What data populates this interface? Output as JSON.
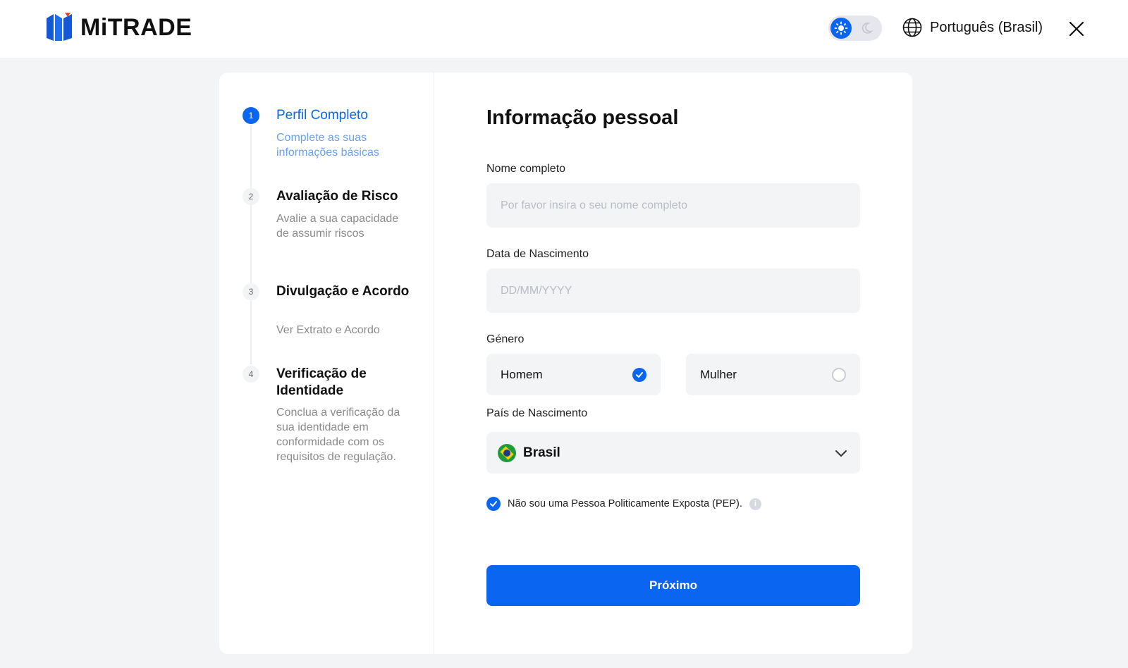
{
  "header": {
    "brand": "MiTRADE",
    "language": "Português (Brasil)"
  },
  "steps": [
    {
      "number": "1",
      "title": "Perfil Completo",
      "description": "Complete as suas informações básicas",
      "active": true
    },
    {
      "number": "2",
      "title": "Avaliação de Risco",
      "description": "Avalie a sua capacidade de assumir riscos",
      "active": false
    },
    {
      "number": "3",
      "title": "Divulgação e Acordo",
      "description": "Ver Extrato e Acordo",
      "active": false
    },
    {
      "number": "4",
      "title": "Verificação de Identidade",
      "description": "Conclua a verificação da sua identidade em conformidade com os requisitos de regulação.",
      "active": false
    }
  ],
  "form": {
    "title": "Informação pessoal",
    "full_name": {
      "label": "Nome completo",
      "placeholder": "Por favor insira o seu nome completo",
      "value": ""
    },
    "birth_date": {
      "label": "Data de Nascimento",
      "placeholder": "DD/MM/YYYY",
      "value": ""
    },
    "gender": {
      "label": "Género",
      "options": [
        "Homem",
        "Mulher"
      ],
      "selected": "Homem"
    },
    "birth_country": {
      "label": "País de Nascimento",
      "value": "Brasil"
    },
    "pep": {
      "label": "Não sou uma Pessoa Politicamente Exposta (PEP).",
      "checked": true
    },
    "next_label": "Próximo"
  },
  "colors": {
    "accent": "#0a66f0",
    "field_bg": "#f3f4f6",
    "page_bg": "#f3f4f6"
  },
  "icons": [
    "mitrade-logo-icon",
    "sun-icon",
    "moon-icon",
    "globe-icon",
    "close-icon",
    "check-icon",
    "chevron-down-icon",
    "info-icon",
    "brazil-flag-icon"
  ]
}
